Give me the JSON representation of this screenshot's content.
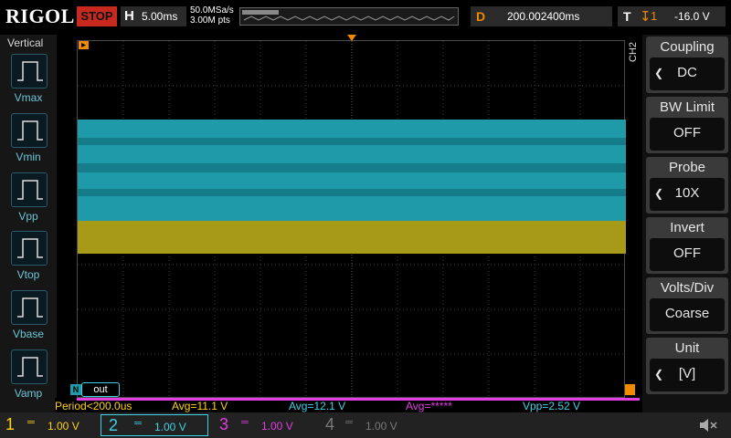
{
  "topbar": {
    "brand": "RIGOL",
    "run_status": "STOP",
    "horizontal_key": "H",
    "timebase": "5.00ms",
    "sample_rate": "50.0MSa/s",
    "mem_depth": "3.00M pts",
    "delay_key": "D",
    "delay": "200.002400ms",
    "trigger_key": "T",
    "trigger_level": "-16.0 V"
  },
  "left_panel": {
    "title": "Vertical",
    "items": [
      "Vmax",
      "Vmin",
      "Vpp",
      "Vtop",
      "Vbase",
      "Vamp"
    ]
  },
  "right_menu": {
    "channel_tag": "CH2",
    "items": [
      {
        "title": "Coupling",
        "value": "DC",
        "arrow": true
      },
      {
        "title": "BW Limit",
        "value": "OFF",
        "arrow": false
      },
      {
        "title": "Probe",
        "value": "10X",
        "arrow": true
      },
      {
        "title": "Invert",
        "value": "OFF",
        "arrow": false
      },
      {
        "title": "Volts/Div",
        "value": "Coarse",
        "arrow": false
      },
      {
        "title": "Unit",
        "value": "[V]",
        "arrow": true
      }
    ]
  },
  "screen": {
    "label": "out",
    "ch_marker": "N"
  },
  "measurements": {
    "period": "Period<200.0us",
    "avg1": "Avg=11.1 V",
    "avg2": "Avg=12.1 V",
    "avg3": "Avg=*****",
    "vpp": "Vpp=2.52 V"
  },
  "channels": [
    {
      "num": "1",
      "scale": "1.00 V",
      "color": "#ffd21a"
    },
    {
      "num": "2",
      "scale": "1.00 V",
      "color": "#3fd2e6"
    },
    {
      "num": "3",
      "scale": "1.00 V",
      "color": "#e23ee0"
    },
    {
      "num": "4",
      "scale": "1.00 V",
      "color": "#6a6a6a"
    }
  ],
  "colors": {
    "ch1": "#a69a18",
    "ch2": "#1e9aa8",
    "stop": "#c8291f",
    "accent": "#f08a00"
  }
}
